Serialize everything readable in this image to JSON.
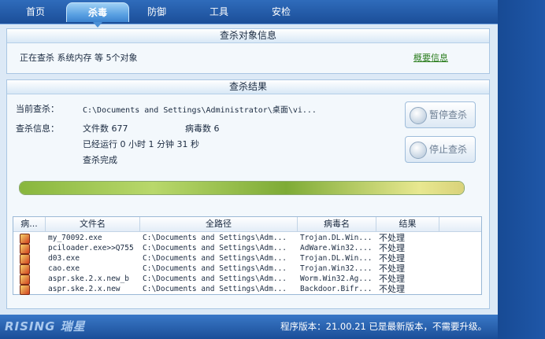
{
  "tabs": [
    {
      "label": "首页"
    },
    {
      "label": "杀毒",
      "active": true
    },
    {
      "label": "防御"
    },
    {
      "label": "工具"
    },
    {
      "label": "安检"
    }
  ],
  "target_panel": {
    "title": "查杀对象信息",
    "status": "正在查杀 系统内存 等 5个对象",
    "summary_link": "概要信息"
  },
  "result_panel": {
    "title": "查杀结果",
    "current_label": "当前查杀：",
    "current_path": "C:\\Documents and Settings\\Administrator\\桌面\\vi...",
    "info_label": "查杀信息：",
    "file_count": "文件数 677",
    "virus_count": "病毒数 6",
    "runtime": "已经运行 0 小时 1 分钟 31  秒",
    "complete": "查杀完成",
    "pause_button": "暂停查杀",
    "stop_button": "停止查杀",
    "progress": 1.0
  },
  "table": {
    "headers": [
      "病...",
      "文件名",
      "全路径",
      "病毒名",
      "结果"
    ],
    "rows": [
      {
        "file": "my_70092.exe",
        "path": "C:\\Documents and Settings\\Adm...",
        "virus": "Trojan.DL.Win...",
        "result": "不处理"
      },
      {
        "file": "pciloader.exe>>Q755",
        "path": "C:\\Documents and Settings\\Adm...",
        "virus": "AdWare.Win32....",
        "result": "不处理"
      },
      {
        "file": "d03.exe",
        "path": "C:\\Documents and Settings\\Adm...",
        "virus": "Trojan.DL.Win...",
        "result": "不处理"
      },
      {
        "file": "cao.exe",
        "path": "C:\\Documents and Settings\\Adm...",
        "virus": "Trojan.Win32....",
        "result": "不处理"
      },
      {
        "file": "aspr.ske.2.x.new_b",
        "path": "C:\\Documents and Settings\\Adm...",
        "virus": "Worm.Win32.Ag...",
        "result": "不处理"
      },
      {
        "file": "aspr.ske.2.x.new",
        "path": "C:\\Documents and Settings\\Adm...",
        "virus": "Backdoor.Bifr...",
        "result": "不处理"
      }
    ]
  },
  "footer": {
    "logo": "RISING 瑞星",
    "version": "程序版本：21.00.21  已是最新版本，不需要升级。"
  }
}
